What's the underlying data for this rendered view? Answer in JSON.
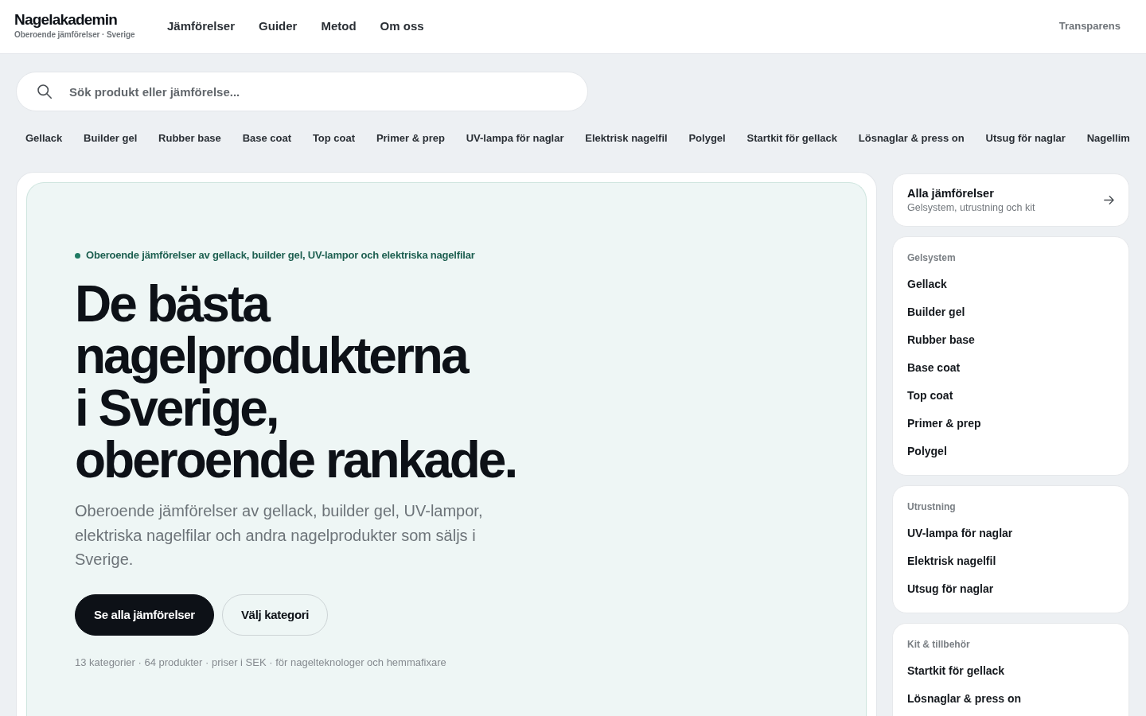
{
  "header": {
    "logo": "Nagelakademin",
    "tagline": "Oberoende jämförelser · Sverige",
    "nav": [
      "Jämförelser",
      "Guider",
      "Metod",
      "Om oss"
    ],
    "secondary_link": "Transparens"
  },
  "search": {
    "placeholder": "Sök produkt eller jämförelse..."
  },
  "category_links": [
    "Gellack",
    "Builder gel",
    "Rubber base",
    "Base coat",
    "Top coat",
    "Primer & prep",
    "UV-lampa för naglar",
    "Elektrisk nagelfil",
    "Polygel",
    "Startkit för gellack",
    "Lösnaglar & press on",
    "Utsug för naglar",
    "Nagellim"
  ],
  "hero": {
    "eyebrow": "Oberoende jämförelser av gellack, builder gel, UV-lampor och elektriska nagelfilar",
    "title": "De bästa\nnagelprodukterna\ni Sverige,\noberoende rankade.",
    "description": "Oberoende jämförelser av gellack, builder gel, UV-lampor, elektriska nagelfilar och andra nagelprodukter som säljs i Sverige.",
    "buttons": [
      {
        "label": "Se alla jämförelser",
        "kind": "primary"
      },
      {
        "label": "Välj kategori",
        "kind": "secondary"
      }
    ],
    "stats": "13 kategorier · 64 produkter · priser i SEK · för nagelteknologer och hemmafixare"
  },
  "sidebar": {
    "all_link": {
      "title": "Alla jämförelser",
      "subtitle": "Gelsystem, utrustning och kit"
    },
    "groups": [
      {
        "heading": "Gelsystem",
        "items": [
          "Gellack",
          "Builder gel",
          "Rubber base",
          "Base coat",
          "Top coat",
          "Primer & prep",
          "Polygel"
        ]
      },
      {
        "heading": "Utrustning",
        "items": [
          "UV-lampa för naglar",
          "Elektrisk nagelfil",
          "Utsug för naglar"
        ]
      },
      {
        "heading": "Kit & tillbehör",
        "items": [
          "Startkit för gellack",
          "Lösnaglar & press on"
        ]
      }
    ]
  }
}
